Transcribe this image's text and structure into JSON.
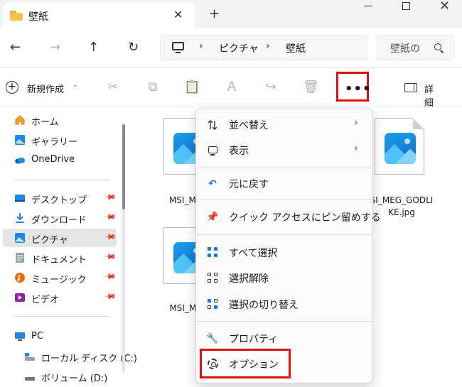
{
  "window": {
    "tab_title": "壁紙",
    "tab_close": "✕",
    "new_tab": "+"
  },
  "nav": {
    "back": "←",
    "forward": "→",
    "up": "↑",
    "refresh": "↻"
  },
  "address": {
    "separator": "›",
    "crumbs": [
      "ピクチャ",
      "壁紙"
    ]
  },
  "search": {
    "placeholder": "壁紙の"
  },
  "toolbar": {
    "new_label": "新規作成",
    "new_caret": "⌄",
    "more_label": "•••",
    "detail_label": "詳細"
  },
  "sidebar": {
    "group1": [
      {
        "label": "ホーム",
        "icon": "home-icon"
      },
      {
        "label": "ギャラリー",
        "icon": "gallery-icon"
      },
      {
        "label": "OneDrive",
        "icon": "onedrive-icon"
      }
    ],
    "group2": [
      {
        "label": "デスクトップ",
        "icon": "desktop-icon"
      },
      {
        "label": "ダウンロード",
        "icon": "download-icon"
      },
      {
        "label": "ピクチャ",
        "icon": "pictures-icon"
      },
      {
        "label": "ドキュメント",
        "icon": "documents-icon"
      },
      {
        "label": "ミュージック",
        "icon": "music-icon"
      },
      {
        "label": "ビデオ",
        "icon": "video-icon"
      }
    ],
    "group3": [
      {
        "label": "PC",
        "icon": "pc-icon"
      },
      {
        "label": "ローカル ディスク (C:)",
        "icon": "drive-icon"
      },
      {
        "label": "ボリューム (D:)",
        "icon": "drive-icon"
      }
    ]
  },
  "files": [
    {
      "name_line1": "MSI_MA",
      "name_line2": ""
    },
    {
      "name_line1": "SI_MEG_GODLI",
      "name_line2": "KE.jpg"
    },
    {
      "name_line1": "MSI_MP",
      "name_line2": ""
    }
  ],
  "context_menu": {
    "items": [
      {
        "label": "並べ替え",
        "has_submenu": true
      },
      {
        "label": "表示",
        "has_submenu": true
      },
      {
        "label": "元に戻す"
      },
      {
        "label": "クイック アクセスにピン留めする"
      },
      {
        "label": "すべて選択"
      },
      {
        "label": "選択解除"
      },
      {
        "label": "選択の切り替え"
      },
      {
        "label": "プロパティ"
      },
      {
        "label": "オプション"
      }
    ],
    "submenu_arrow": "›"
  },
  "colors": {
    "highlight_box": "#e01010",
    "accent": "#1a73e8"
  }
}
